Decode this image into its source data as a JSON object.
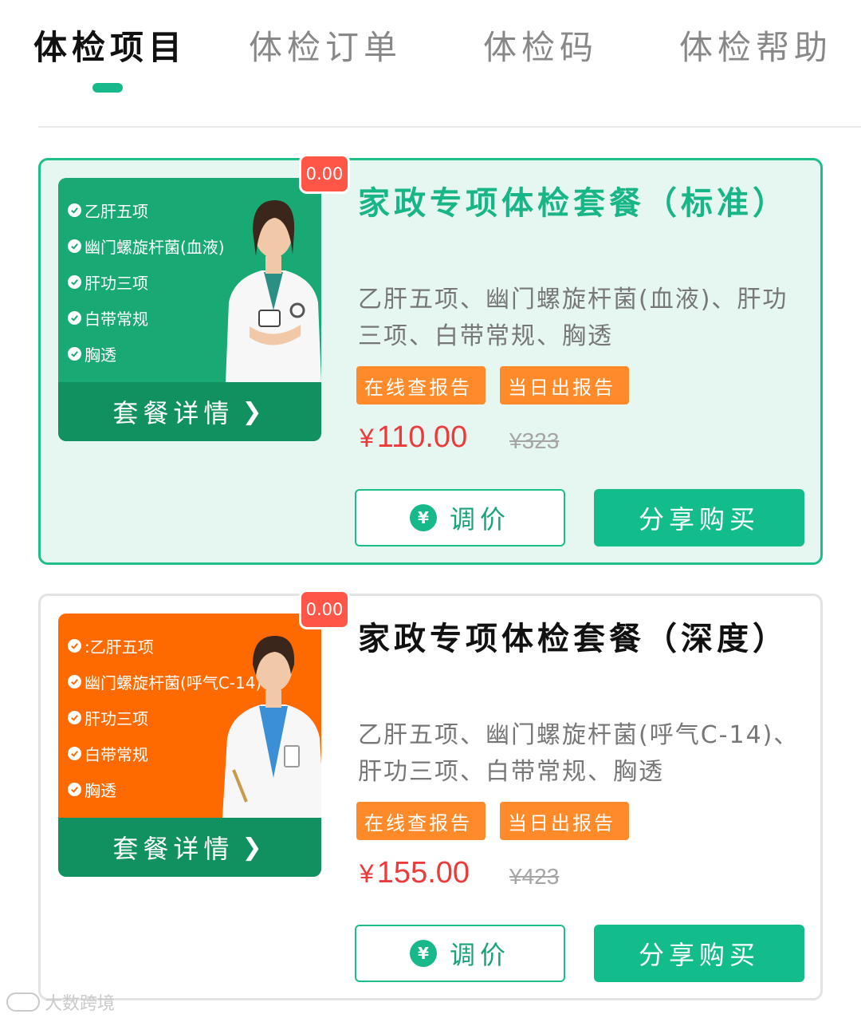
{
  "tabs": [
    {
      "label": "体检项目",
      "active": true
    },
    {
      "label": "体检订单",
      "active": false
    },
    {
      "label": "体检码",
      "active": false
    },
    {
      "label": "体检帮助",
      "active": false
    }
  ],
  "colors": {
    "accent": "#17b98a",
    "price": "#ec3b3b",
    "tag": "#ff8a2a",
    "badge": "#ff5648",
    "orange_thumb": "#ff6a00"
  },
  "packages": [
    {
      "badge": "0.00",
      "thumb_items": [
        "乙肝五项",
        "幽门螺旋杆菌(血液)",
        "肝功三项",
        "白带常规",
        "胸透"
      ],
      "thumb_button": "套餐详情",
      "title": "家政专项体检套餐（标准）",
      "description": "乙肝五项、幽门螺旋杆菌(血液)、肝功三项、白带常规、胸透",
      "tags": [
        "在线查报告",
        "当日出报告"
      ],
      "currency": "¥",
      "price": "110.00",
      "original_price": "¥323",
      "adjust_button": "调价",
      "adjust_icon_text": "¥",
      "buy_button": "分享购买"
    },
    {
      "badge": "0.00",
      "thumb_items": [
        ":乙肝五项",
        "幽门螺旋杆菌(呼气C-14)",
        "肝功三项",
        "白带常规",
        "胸透"
      ],
      "thumb_button": "套餐详情",
      "title": "家政专项体检套餐（深度）",
      "description": "乙肝五项、幽门螺旋杆菌(呼气C-14)、肝功三项、白带常规、胸透",
      "tags": [
        "在线查报告",
        "当日出报告"
      ],
      "currency": "¥",
      "price": "155.00",
      "original_price": "¥423",
      "adjust_button": "调价",
      "adjust_icon_text": "¥",
      "buy_button": "分享购买"
    }
  ],
  "watermark": "大数跨境"
}
